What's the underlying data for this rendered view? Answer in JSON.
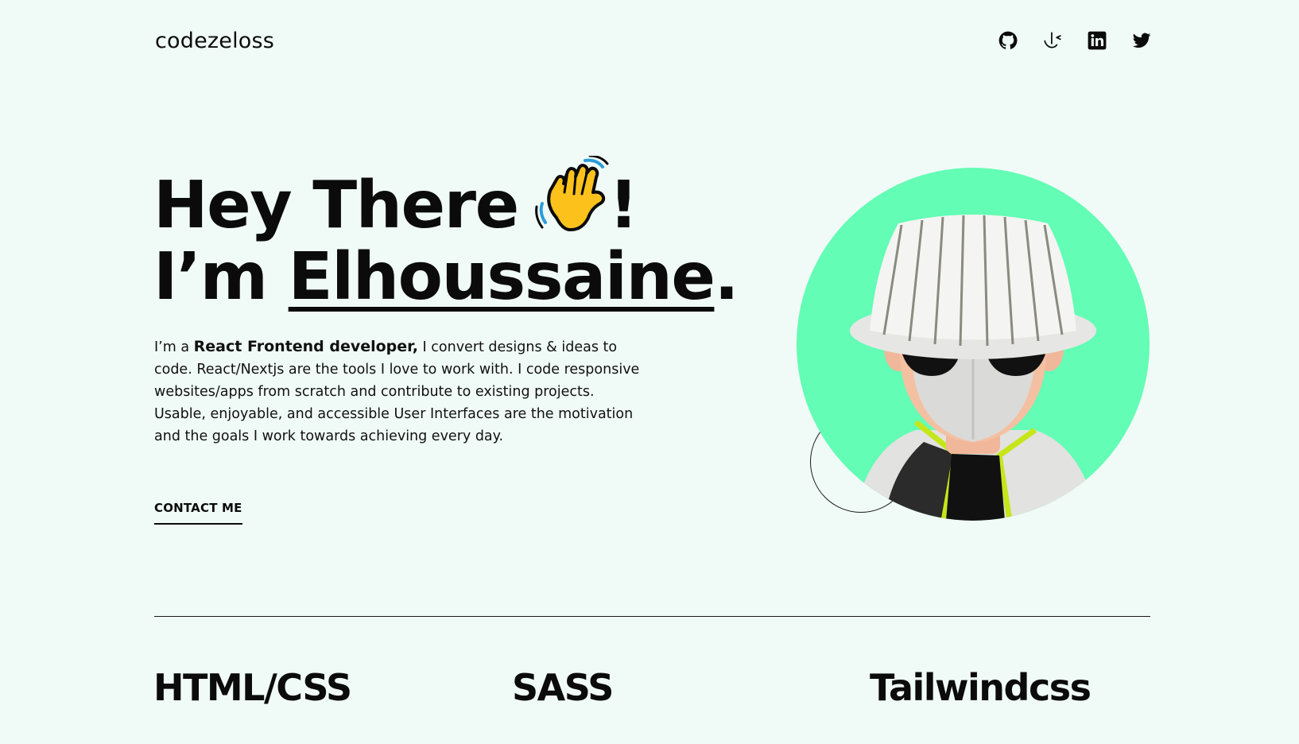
{
  "header": {
    "logo": "codezeloss",
    "social": [
      {
        "name": "GitHub",
        "icon": "github-icon"
      },
      {
        "name": "Frontend Mentor",
        "icon": "frontend-mentor-icon"
      },
      {
        "name": "LinkedIn",
        "icon": "linkedin-icon"
      },
      {
        "name": "Twitter",
        "icon": "twitter-icon"
      }
    ]
  },
  "hero": {
    "greeting": "Hey There",
    "greeting_end": "!",
    "im": "I’m",
    "name": "Elhoussaine",
    "name_end": ".",
    "intro_pre": "I’m a",
    "intro_role": "React Frontend developer,",
    "intro_rest": "I convert designs & ideas to code. React/Nextjs are the tools I love to work with. I code responsive websites/apps from scratch and contribute to existing projects. Usable, enjoyable, and accessible User Interfaces are the motivation and the goals I work towards achieving every day.",
    "contact_label": "CONTACT ME",
    "wave_icon": "waving-hand-icon",
    "avatar_icon": "avatar-illustration"
  },
  "skills": [
    "HTML/CSS",
    "SASS",
    "Tailwindcss"
  ],
  "colors": {
    "background": "#f0fbf7",
    "accent": "#63fdb5",
    "text": "#0b0b0b"
  }
}
